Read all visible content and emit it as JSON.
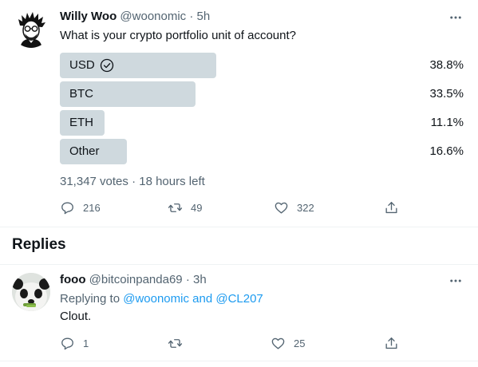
{
  "tweet": {
    "author_name": "Willy Woo",
    "author_handle": "@woonomic",
    "separator": "·",
    "time": "5h",
    "text": "What is your crypto portfolio unit of account?",
    "poll": {
      "options": [
        {
          "label": "USD",
          "percent": "38.8%",
          "share": 0.388,
          "selected": true
        },
        {
          "label": "BTC",
          "percent": "33.5%",
          "share": 0.335,
          "selected": false
        },
        {
          "label": "ETH",
          "percent": "11.1%",
          "share": 0.111,
          "selected": false
        },
        {
          "label": "Other",
          "percent": "16.6%",
          "share": 0.166,
          "selected": false
        }
      ],
      "meta": "31,347 votes · 18 hours left"
    },
    "actions": {
      "replies": "216",
      "retweets": "49",
      "likes": "322"
    },
    "more_icon": "ellipsis-icon"
  },
  "replies_section": {
    "heading": "Replies"
  },
  "reply": {
    "author_name": "fooo",
    "author_handle": "@bitcoinpanda69",
    "separator": "·",
    "time": "3h",
    "replying_prefix": "Replying to ",
    "replying_to": "@woonomic and @CL207",
    "text": "Clout.",
    "actions": {
      "replies": "1",
      "retweets": "",
      "likes": "25"
    }
  },
  "colors": {
    "poll_bar": "#cfd9de",
    "link": "#1d9bf0",
    "secondary_text": "#536471"
  }
}
